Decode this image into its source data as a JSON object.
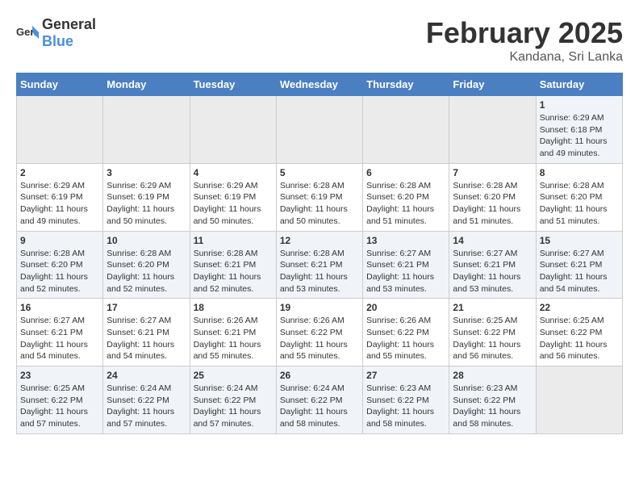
{
  "header": {
    "logo_general": "General",
    "logo_blue": "Blue",
    "month_year": "February 2025",
    "location": "Kandana, Sri Lanka"
  },
  "days_of_week": [
    "Sunday",
    "Monday",
    "Tuesday",
    "Wednesday",
    "Thursday",
    "Friday",
    "Saturday"
  ],
  "weeks": [
    [
      {
        "day": "",
        "info": ""
      },
      {
        "day": "",
        "info": ""
      },
      {
        "day": "",
        "info": ""
      },
      {
        "day": "",
        "info": ""
      },
      {
        "day": "",
        "info": ""
      },
      {
        "day": "",
        "info": ""
      },
      {
        "day": "1",
        "info": "Sunrise: 6:29 AM\nSunset: 6:18 PM\nDaylight: 11 hours and 49 minutes."
      }
    ],
    [
      {
        "day": "2",
        "info": "Sunrise: 6:29 AM\nSunset: 6:19 PM\nDaylight: 11 hours and 49 minutes."
      },
      {
        "day": "3",
        "info": "Sunrise: 6:29 AM\nSunset: 6:19 PM\nDaylight: 11 hours and 50 minutes."
      },
      {
        "day": "4",
        "info": "Sunrise: 6:29 AM\nSunset: 6:19 PM\nDaylight: 11 hours and 50 minutes."
      },
      {
        "day": "5",
        "info": "Sunrise: 6:28 AM\nSunset: 6:19 PM\nDaylight: 11 hours and 50 minutes."
      },
      {
        "day": "6",
        "info": "Sunrise: 6:28 AM\nSunset: 6:20 PM\nDaylight: 11 hours and 51 minutes."
      },
      {
        "day": "7",
        "info": "Sunrise: 6:28 AM\nSunset: 6:20 PM\nDaylight: 11 hours and 51 minutes."
      },
      {
        "day": "8",
        "info": "Sunrise: 6:28 AM\nSunset: 6:20 PM\nDaylight: 11 hours and 51 minutes."
      }
    ],
    [
      {
        "day": "9",
        "info": "Sunrise: 6:28 AM\nSunset: 6:20 PM\nDaylight: 11 hours and 52 minutes."
      },
      {
        "day": "10",
        "info": "Sunrise: 6:28 AM\nSunset: 6:20 PM\nDaylight: 11 hours and 52 minutes."
      },
      {
        "day": "11",
        "info": "Sunrise: 6:28 AM\nSunset: 6:21 PM\nDaylight: 11 hours and 52 minutes."
      },
      {
        "day": "12",
        "info": "Sunrise: 6:28 AM\nSunset: 6:21 PM\nDaylight: 11 hours and 53 minutes."
      },
      {
        "day": "13",
        "info": "Sunrise: 6:27 AM\nSunset: 6:21 PM\nDaylight: 11 hours and 53 minutes."
      },
      {
        "day": "14",
        "info": "Sunrise: 6:27 AM\nSunset: 6:21 PM\nDaylight: 11 hours and 53 minutes."
      },
      {
        "day": "15",
        "info": "Sunrise: 6:27 AM\nSunset: 6:21 PM\nDaylight: 11 hours and 54 minutes."
      }
    ],
    [
      {
        "day": "16",
        "info": "Sunrise: 6:27 AM\nSunset: 6:21 PM\nDaylight: 11 hours and 54 minutes."
      },
      {
        "day": "17",
        "info": "Sunrise: 6:27 AM\nSunset: 6:21 PM\nDaylight: 11 hours and 54 minutes."
      },
      {
        "day": "18",
        "info": "Sunrise: 6:26 AM\nSunset: 6:21 PM\nDaylight: 11 hours and 55 minutes."
      },
      {
        "day": "19",
        "info": "Sunrise: 6:26 AM\nSunset: 6:22 PM\nDaylight: 11 hours and 55 minutes."
      },
      {
        "day": "20",
        "info": "Sunrise: 6:26 AM\nSunset: 6:22 PM\nDaylight: 11 hours and 55 minutes."
      },
      {
        "day": "21",
        "info": "Sunrise: 6:25 AM\nSunset: 6:22 PM\nDaylight: 11 hours and 56 minutes."
      },
      {
        "day": "22",
        "info": "Sunrise: 6:25 AM\nSunset: 6:22 PM\nDaylight: 11 hours and 56 minutes."
      }
    ],
    [
      {
        "day": "23",
        "info": "Sunrise: 6:25 AM\nSunset: 6:22 PM\nDaylight: 11 hours and 57 minutes."
      },
      {
        "day": "24",
        "info": "Sunrise: 6:24 AM\nSunset: 6:22 PM\nDaylight: 11 hours and 57 minutes."
      },
      {
        "day": "25",
        "info": "Sunrise: 6:24 AM\nSunset: 6:22 PM\nDaylight: 11 hours and 57 minutes."
      },
      {
        "day": "26",
        "info": "Sunrise: 6:24 AM\nSunset: 6:22 PM\nDaylight: 11 hours and 58 minutes."
      },
      {
        "day": "27",
        "info": "Sunrise: 6:23 AM\nSunset: 6:22 PM\nDaylight: 11 hours and 58 minutes."
      },
      {
        "day": "28",
        "info": "Sunrise: 6:23 AM\nSunset: 6:22 PM\nDaylight: 11 hours and 58 minutes."
      },
      {
        "day": "",
        "info": ""
      }
    ]
  ]
}
